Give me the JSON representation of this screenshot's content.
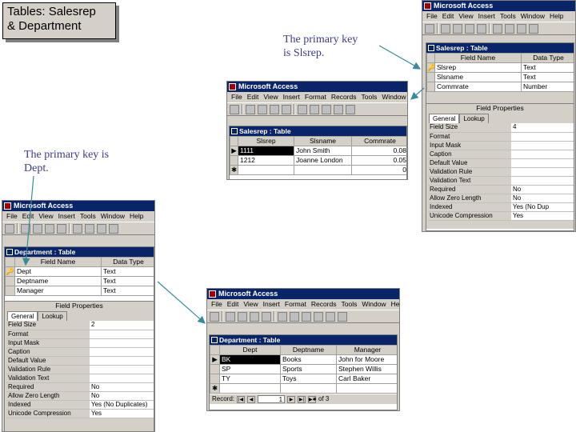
{
  "heading": {
    "line1": "Tables: Salesrep",
    "line2": "& Department"
  },
  "notes": {
    "salesrep_key_line1": "The primary key",
    "salesrep_key_line2": "is Slsrep.",
    "dept_key_line1": "The primary key is",
    "dept_key_line2": "Dept."
  },
  "app_title": "Microsoft Access",
  "menus": [
    "File",
    "Edit",
    "View",
    "Insert",
    "Format",
    "Records",
    "Tools",
    "Window",
    "Help"
  ],
  "salesrep_design": {
    "title": "Salesrep : Table",
    "headers": [
      "Field Name",
      "Data Type"
    ],
    "rows": [
      [
        "Slsrep",
        "Text"
      ],
      [
        "Slsname",
        "Text"
      ],
      [
        "Commrate",
        "Number"
      ]
    ],
    "field_properties_label": "Field Properties",
    "tabs": [
      "General",
      "Lookup"
    ],
    "props": [
      [
        "Field Size",
        "4"
      ],
      [
        "Format",
        ""
      ],
      [
        "Input Mask",
        ""
      ],
      [
        "Caption",
        ""
      ],
      [
        "Default Value",
        ""
      ],
      [
        "Validation Rule",
        ""
      ],
      [
        "Validation Text",
        ""
      ],
      [
        "Required",
        "No"
      ],
      [
        "Allow Zero Length",
        "No"
      ],
      [
        "Indexed",
        "Yes (No Dup"
      ],
      [
        "Unicode Compression",
        "Yes"
      ]
    ]
  },
  "salesrep_data": {
    "title": "Salesrep : Table",
    "headers": [
      "Slsrep",
      "Slsname",
      "Commrate"
    ],
    "rows": [
      [
        "1111",
        "John Smith",
        "0.08"
      ],
      [
        "1212",
        "Joanne London",
        "0.05"
      ],
      [
        "",
        "",
        "0"
      ]
    ]
  },
  "department_design": {
    "title": "Department : Table",
    "headers": [
      "Field Name",
      "Data Type"
    ],
    "rows": [
      [
        "Dept",
        "Text"
      ],
      [
        "Deptname",
        "Text"
      ],
      [
        "Manager",
        "Text"
      ]
    ],
    "field_properties_label": "Field Properties",
    "tabs": [
      "General",
      "Lookup"
    ],
    "props": [
      [
        "Field Size",
        "2"
      ],
      [
        "Format",
        ""
      ],
      [
        "Input Mask",
        ""
      ],
      [
        "Caption",
        ""
      ],
      [
        "Default Value",
        ""
      ],
      [
        "Validation Rule",
        ""
      ],
      [
        "Validation Text",
        ""
      ],
      [
        "Required",
        "No"
      ],
      [
        "Allow Zero Length",
        "No"
      ],
      [
        "Indexed",
        "Yes (No Duplicates)"
      ],
      [
        "Unicode Compression",
        "Yes"
      ]
    ]
  },
  "department_data": {
    "title": "Department : Table",
    "headers": [
      "Dept",
      "Deptname",
      "Manager"
    ],
    "rows": [
      [
        "BK",
        "Books",
        "John for Moore"
      ],
      [
        "SP",
        "Sports",
        "Stephen Willis"
      ],
      [
        "TY",
        "Toys",
        "Carl Baker"
      ]
    ],
    "record_label": "Record:",
    "record_value": "1",
    "record_total": "of 3"
  },
  "colors": {
    "titlebar": "#0a246a",
    "chrome": "#d4d0c8",
    "arrow": "#3a8a9a"
  }
}
